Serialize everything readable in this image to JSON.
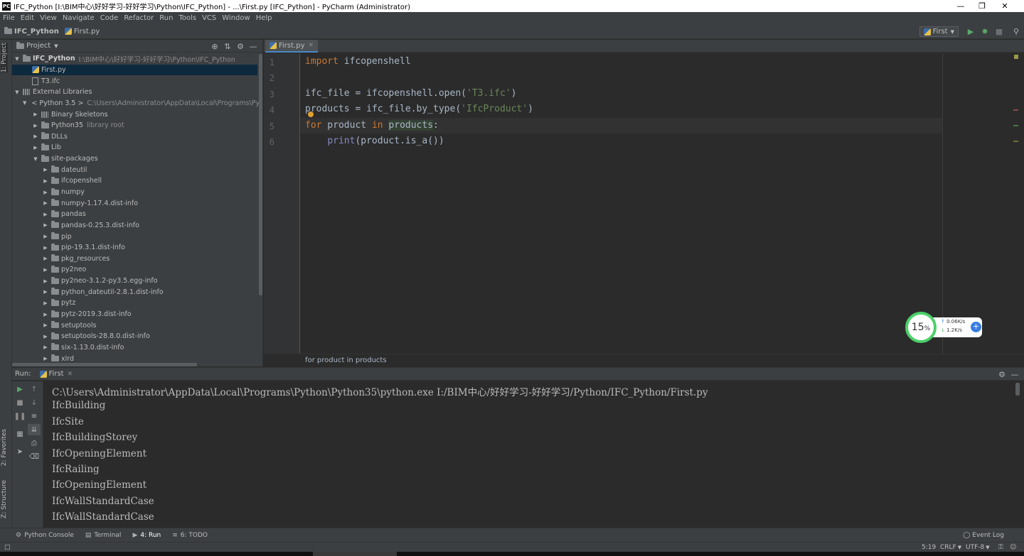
{
  "window": {
    "title": "IFC_Python [I:\\BIM中心\\好好学习-好好学习\\Python\\IFC_Python] - ...\\First.py [IFC_Python] - PyCharm (Administrator)",
    "app_icon": "PC"
  },
  "menu": [
    "File",
    "Edit",
    "View",
    "Navigate",
    "Code",
    "Refactor",
    "Run",
    "Tools",
    "VCS",
    "Window",
    "Help"
  ],
  "navbar": {
    "project": "IFC_Python",
    "file": "First.py",
    "run_config": "First"
  },
  "side_tabs": {
    "project": "1: Project",
    "favorites": "2: Favorites",
    "structure": "Z: Structure"
  },
  "project_panel": {
    "header": "Project",
    "tree": [
      {
        "label": "IFC_Python",
        "path": "I:\\BIM中心\\好好学习-好好学习\\Python\\IFC_Python"
      },
      {
        "label": "First.py"
      },
      {
        "label": "T3.ifc"
      },
      {
        "label": "External Libraries"
      },
      {
        "label": "< Python 3.5 >",
        "path": "C:\\Users\\Administrator\\AppData\\Local\\Programs\\Pytho"
      },
      {
        "label": "Binary Skeletons"
      },
      {
        "label": "Python35",
        "path": "library root"
      },
      {
        "label": "DLLs"
      },
      {
        "label": "Lib"
      },
      {
        "label": "site-packages"
      },
      {
        "label": "dateutil"
      },
      {
        "label": "ifcopenshell"
      },
      {
        "label": "numpy"
      },
      {
        "label": "numpy-1.17.4.dist-info"
      },
      {
        "label": "pandas"
      },
      {
        "label": "pandas-0.25.3.dist-info"
      },
      {
        "label": "pip"
      },
      {
        "label": "pip-19.3.1.dist-info"
      },
      {
        "label": "pkg_resources"
      },
      {
        "label": "py2neo"
      },
      {
        "label": "py2neo-3.1.2-py3.5.egg-info"
      },
      {
        "label": "python_dateutil-2.8.1.dist-info"
      },
      {
        "label": "pytz"
      },
      {
        "label": "pytz-2019.3.dist-info"
      },
      {
        "label": "setuptools"
      },
      {
        "label": "setuptools-28.8.0.dist-info"
      },
      {
        "label": "six-1.13.0.dist-info"
      },
      {
        "label": "xlrd"
      }
    ]
  },
  "editor": {
    "tab": "First.py",
    "lines": [
      "1",
      "2",
      "3",
      "4",
      "5",
      "6"
    ],
    "code": {
      "l1_kw": "import",
      "l1_rest": " ifcopenshell",
      "l3_a": "ifc_file = ifcopenshell.open(",
      "l3_str": "'T3.ifc'",
      "l3_b": ")",
      "l4_a": "products = ifc_file.by_type(",
      "l4_str": "'IfcProduct'",
      "l4_b": ")",
      "l5_kw1": "for",
      "l5_a": " product ",
      "l5_kw2": "in",
      "l5_sp": " ",
      "l5_hl": "products",
      "l5_b": ":",
      "l6_indent": "    ",
      "l6_fn": "print",
      "l6_rest": "(product.is_a())"
    },
    "breadcrumb": "for product in products"
  },
  "net_widget": {
    "percent": "15",
    "percent_unit": "%",
    "up": "0.06K/s",
    "down": "1.2K/s"
  },
  "run_panel": {
    "label": "Run:",
    "tab": "First",
    "output": [
      "C:\\Users\\Administrator\\AppData\\Local\\Programs\\Python\\Python35\\python.exe I:/BIM中心/好好学习-好好学习/Python/IFC_Python/First.py",
      "IfcBuilding",
      "IfcSite",
      "IfcBuildingStorey",
      "IfcOpeningElement",
      "IfcRailing",
      "IfcOpeningElement",
      "IfcWallStandardCase",
      "IfcWallStandardCase"
    ]
  },
  "bottom_tabs": [
    "Python Console",
    "Terminal",
    "4: Run",
    "6: TODO"
  ],
  "event_log": "Event Log",
  "status": {
    "position": "5:19",
    "line_sep": "CRLF",
    "encoding": "UTF-8"
  }
}
